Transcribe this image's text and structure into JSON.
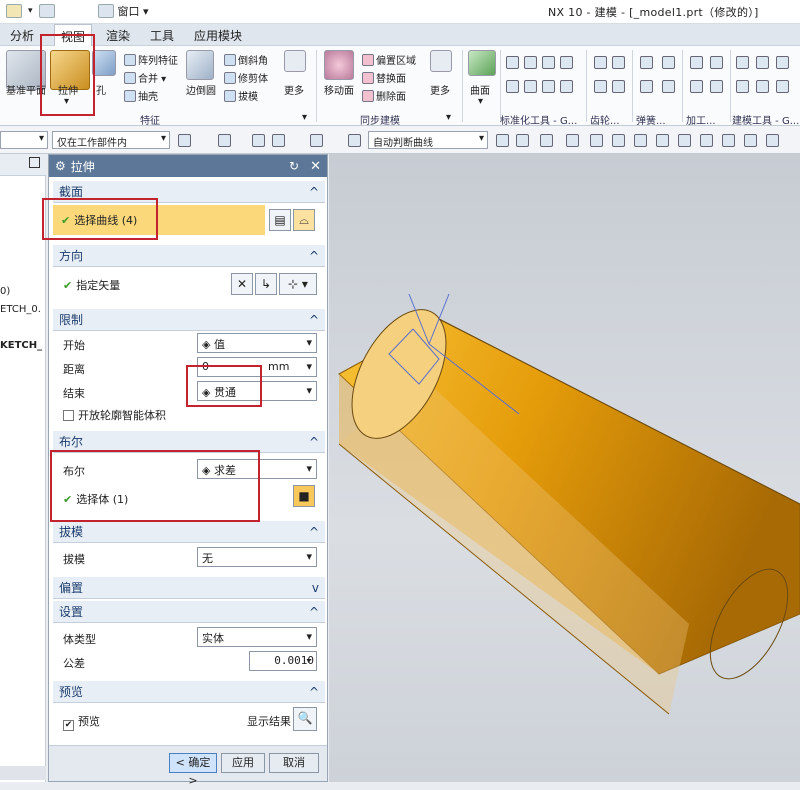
{
  "window": {
    "title": "NX 10 - 建模 - [_model1.prt（修改的）]",
    "window_menu": "窗口"
  },
  "menubar": [
    "分析",
    "视图",
    "渲染",
    "工具",
    "应用模块"
  ],
  "ribbon": {
    "datum_plane": "基准平面",
    "extrude": "拉伸",
    "hole": "孔",
    "pattern_feature": "阵列特征",
    "unite": "合并",
    "shell": "抽壳",
    "edge_blend": "边倒圆",
    "chamfer": "倒斜角",
    "trim_body": "修剪体",
    "draft": "拔模",
    "more1": "更多",
    "move_face": "移动面",
    "offset_region": "偏置区域",
    "replace_face": "替换面",
    "delete_face": "删除面",
    "more2": "更多",
    "surface": "曲面",
    "group_feature": "特征",
    "group_sync": "同步建模",
    "group_std": "标准化工具 - G...",
    "group_gear": "齿轮...",
    "group_spring": "弹簧...",
    "group_machining": "加工...",
    "group_build": "建模工具 - G..."
  },
  "filterbar": {
    "scope": "仅在工作部件内",
    "curve_rule": "自动判断曲线"
  },
  "leftnav": [
    "0)",
    "ETCH_0.",
    "KETCH_"
  ],
  "dialog": {
    "title": "拉伸",
    "section": {
      "header": "截面",
      "select_curve": "选择曲线 (4)"
    },
    "direction": {
      "header": "方向",
      "specify_vector": "指定矢量"
    },
    "limits": {
      "header": "限制",
      "start_label": "开始",
      "start_value": "值",
      "distance_label": "距离",
      "distance_value": "0",
      "distance_unit": "mm",
      "end_label": "结束",
      "end_value": "贯通",
      "open_profile": "开放轮廓智能体积"
    },
    "boolean": {
      "header": "布尔",
      "bool_label": "布尔",
      "bool_value": "求差",
      "select_body": "选择体 (1)"
    },
    "draft": {
      "header": "拔模",
      "draft_label": "拔模",
      "draft_value": "无"
    },
    "offset": {
      "header": "偏置"
    },
    "settings": {
      "header": "设置",
      "body_type_label": "体类型",
      "body_type_value": "实体",
      "tolerance_label": "公差",
      "tolerance_value": "0.0010"
    },
    "preview": {
      "header": "预览",
      "preview_label": "预览",
      "show_result": "显示结果"
    },
    "buttons": {
      "ok": "< 确定 >",
      "apply": "应用",
      "cancel": "取消"
    }
  },
  "colors": {
    "accent_red": "#c3232f",
    "body_orange": "#e8a30c",
    "dialog_header": "#5c7797"
  }
}
